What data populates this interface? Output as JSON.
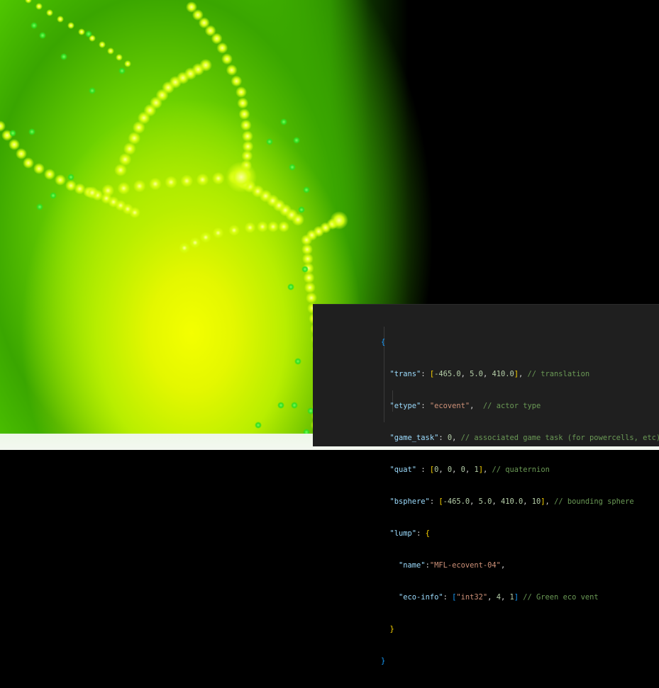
{
  "scene": {
    "name": "green eco vent particle effect",
    "colors": {
      "core": "#f4ff00",
      "glow": "#6fd300",
      "particle": "#d8ff10",
      "spark": "#30dd20",
      "background": "#000000"
    }
  },
  "code": {
    "open_brace": "{",
    "close_brace": "}",
    "trans_key": "\"trans\"",
    "trans_x": "-465.0",
    "trans_y": "5.0",
    "trans_z": "410.0",
    "trans_comment": "// translation",
    "etype_key": "\"etype\"",
    "etype_value": "\"ecovent\"",
    "etype_comment": "// actor type",
    "game_task_key": "\"game_task\"",
    "game_task_value": "0",
    "game_task_comment": "// associated game task (for powercells, etc)",
    "quat_key": "\"quat\"",
    "quat_0": "0",
    "quat_1": "0",
    "quat_2": "0",
    "quat_3": "1",
    "quat_comment": "// quaternion",
    "bsphere_key": "\"bsphere\"",
    "bsphere_0": "-465.0",
    "bsphere_1": "5.0",
    "bsphere_2": "410.0",
    "bsphere_3": "10",
    "bsphere_comment": "// bounding sphere",
    "lump_key": "\"lump\"",
    "name_key": "\"name\"",
    "name_value": "\"MFL-ecovent-04\"",
    "eco_info_key": "\"eco-info\"",
    "eco_info_type": "\"int32\"",
    "eco_info_0": "4",
    "eco_info_1": "1",
    "eco_info_comment": "// Green eco vent",
    "lump_close": "}"
  }
}
